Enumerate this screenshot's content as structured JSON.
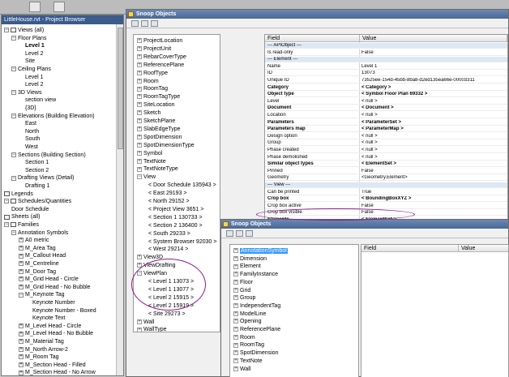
{
  "project_browser": {
    "title": "LittleHouse.rvt - Project Browser",
    "rows": [
      {
        "text": "Views (all)",
        "level": 0,
        "exp": "−",
        "icon": true
      },
      {
        "text": "Floor Plans",
        "level": 1,
        "exp": "−"
      },
      {
        "text": "Level 1",
        "level": 2,
        "bold": true
      },
      {
        "text": "Level 2",
        "level": 2
      },
      {
        "text": "Site",
        "level": 2
      },
      {
        "text": "Ceiling Plans",
        "level": 1,
        "exp": "−"
      },
      {
        "text": "Level 1",
        "level": 2
      },
      {
        "text": "Level 2",
        "level": 2
      },
      {
        "text": "3D Views",
        "level": 1,
        "exp": "−"
      },
      {
        "text": "section view",
        "level": 2
      },
      {
        "text": "{3D}",
        "level": 2
      },
      {
        "text": "Elevations (Building Elevation)",
        "level": 1,
        "exp": "−"
      },
      {
        "text": "East",
        "level": 2
      },
      {
        "text": "North",
        "level": 2
      },
      {
        "text": "South",
        "level": 2
      },
      {
        "text": "West",
        "level": 2
      },
      {
        "text": "Sections (Building Section)",
        "level": 1,
        "exp": "−"
      },
      {
        "text": "Section 1",
        "level": 2
      },
      {
        "text": "Section 2",
        "level": 2
      },
      {
        "text": "Drafting Views (Detail)",
        "level": 1,
        "exp": "−"
      },
      {
        "text": "Drafting 1",
        "level": 2
      },
      {
        "text": "Legends",
        "level": 0,
        "icon": true
      },
      {
        "text": "Schedules/Quantities",
        "level": 0,
        "exp": "−",
        "icon": true
      },
      {
        "text": "Door Schedule",
        "level": 1
      },
      {
        "text": "Sheets (all)",
        "level": 0,
        "icon": true
      },
      {
        "text": "Families",
        "level": 0,
        "exp": "−",
        "icon": true
      },
      {
        "text": "Annotation Symbols",
        "level": 1,
        "exp": "−"
      },
      {
        "text": "A0 metric",
        "level": 2,
        "exp": "+"
      },
      {
        "text": "M_Area Tag",
        "level": 2,
        "exp": "+"
      },
      {
        "text": "M_Callout Head",
        "level": 2,
        "exp": "+"
      },
      {
        "text": "M_Centreline",
        "level": 2,
        "exp": "+"
      },
      {
        "text": "M_Door Tag",
        "level": 2,
        "exp": "+"
      },
      {
        "text": "M_Grid Head - Circle",
        "level": 2,
        "exp": "+"
      },
      {
        "text": "M_Grid Head - No Bubble",
        "level": 2,
        "exp": "+"
      },
      {
        "text": "M_Keynote Tag",
        "level": 2,
        "exp": "−"
      },
      {
        "text": "Keynote Number",
        "level": 3
      },
      {
        "text": "Keynote Number - Boxed",
        "level": 3
      },
      {
        "text": "Keynote Text",
        "level": 3
      },
      {
        "text": "M_Level Head - Circle",
        "level": 2,
        "exp": "+"
      },
      {
        "text": "M_Level Head - No Bubble",
        "level": 2,
        "exp": "+"
      },
      {
        "text": "M_Material Tag",
        "level": 2,
        "exp": "+"
      },
      {
        "text": "M_North Arrow-2",
        "level": 2,
        "exp": "+"
      },
      {
        "text": "M_Room Tag",
        "level": 2,
        "exp": "+"
      },
      {
        "text": "M_Section Head - Filled",
        "level": 2,
        "exp": "+"
      },
      {
        "text": "M_Section Head - No Arrow",
        "level": 2,
        "exp": "+"
      }
    ]
  },
  "snoop1": {
    "title": "Snoop Objects",
    "tree": [
      {
        "text": "ProjectLocation",
        "level": 0,
        "exp": "+"
      },
      {
        "text": "ProjectUnit",
        "level": 0,
        "exp": "+"
      },
      {
        "text": "RebarCoverType",
        "level": 0,
        "exp": "+"
      },
      {
        "text": "ReferencePlane",
        "level": 0,
        "exp": "+"
      },
      {
        "text": "RoofType",
        "level": 0,
        "exp": "+"
      },
      {
        "text": "Room",
        "level": 0,
        "exp": "+"
      },
      {
        "text": "RoomTag",
        "level": 0,
        "exp": "+"
      },
      {
        "text": "RoomTagType",
        "level": 0,
        "exp": "+"
      },
      {
        "text": "SiteLocation",
        "level": 0,
        "exp": "+"
      },
      {
        "text": "Sketch",
        "level": 0,
        "exp": "+"
      },
      {
        "text": "SketchPlane",
        "level": 0,
        "exp": "+"
      },
      {
        "text": "SlabEdgeType",
        "level": 0,
        "exp": "+"
      },
      {
        "text": "SpotDimension",
        "level": 0,
        "exp": "+"
      },
      {
        "text": "SpotDimensionType",
        "level": 0,
        "exp": "+"
      },
      {
        "text": "Symbol",
        "level": 0,
        "exp": "+"
      },
      {
        "text": "TextNote",
        "level": 0,
        "exp": "+"
      },
      {
        "text": "TextNoteType",
        "level": 0,
        "exp": "+"
      },
      {
        "text": "View",
        "level": 0,
        "exp": "−"
      },
      {
        "text": "< Door Schedule  135943 >",
        "level": 1
      },
      {
        "text": "< East  29193 >",
        "level": 1
      },
      {
        "text": "< North  29152 >",
        "level": 1
      },
      {
        "text": "< Project View  3651 >",
        "level": 1
      },
      {
        "text": "< Section 1  130733 >",
        "level": 1
      },
      {
        "text": "< Section 2  136400 >",
        "level": 1
      },
      {
        "text": "< South  29233 >",
        "level": 1
      },
      {
        "text": "< System Browser  92030 >",
        "level": 1
      },
      {
        "text": "< West  29214 >",
        "level": 1
      },
      {
        "text": "View3D",
        "level": 0,
        "exp": "+"
      },
      {
        "text": "ViewDrafting",
        "level": 0,
        "exp": "+"
      },
      {
        "text": "ViewPlan",
        "level": 0,
        "exp": "−"
      },
      {
        "text": "< Level 1  13073 >",
        "level": 1
      },
      {
        "text": "< Level 1  13077 >",
        "level": 1
      },
      {
        "text": "< Level 2  15915 >",
        "level": 1
      },
      {
        "text": "< Level 2  15919 >",
        "level": 1
      },
      {
        "text": "< Site  29273 >",
        "level": 1
      },
      {
        "text": "Wall",
        "level": 0,
        "exp": "+"
      },
      {
        "text": "WallType",
        "level": 0,
        "exp": "+"
      }
    ],
    "grid_headers": {
      "field": "Field",
      "value": "Value"
    },
    "rows": [
      {
        "field": "--- APIObject ---",
        "value": "",
        "type": "cat"
      },
      {
        "field": "Is read-only",
        "value": "False"
      },
      {
        "field": "--- Element ---",
        "value": "",
        "type": "cat"
      },
      {
        "field": "Name",
        "value": "Level 1"
      },
      {
        "field": "ID",
        "value": "13073"
      },
      {
        "field": "Unique ID",
        "value": "73525ee-154d-45bb-8ba8-d2ed135ea66e-00003311"
      },
      {
        "field": "Category",
        "value": "< Category >",
        "bold": true
      },
      {
        "field": "Object type",
        "value": "< Symbol  Floor Plan  69332 >",
        "bold": true
      },
      {
        "field": "Level",
        "value": "< null >"
      },
      {
        "field": "Document",
        "value": "< Document >",
        "bold": true
      },
      {
        "field": "Location",
        "value": "< null >"
      },
      {
        "field": "Parameters",
        "value": "< ParameterSet >",
        "bold": true
      },
      {
        "field": "Parameters map",
        "value": "< ParameterMap >",
        "bold": true
      },
      {
        "field": "Design option",
        "value": "< null >"
      },
      {
        "field": "Group",
        "value": "< null >"
      },
      {
        "field": "Phase created",
        "value": "< null >"
      },
      {
        "field": "Phase demolished",
        "value": "< null >"
      },
      {
        "field": "Similar object types",
        "value": "< ElementSet >",
        "bold": true
      },
      {
        "field": "Pinned",
        "value": "False"
      },
      {
        "field": "Geometry",
        "value": "<Geometry.Element>"
      },
      {
        "field": "--- View ---",
        "value": "",
        "type": "cat"
      },
      {
        "field": "Can be printed",
        "value": "True"
      },
      {
        "field": "Crop box",
        "value": "< BoundingBoxXYZ >",
        "bold": true
      },
      {
        "field": "Crop box active",
        "value": "False"
      },
      {
        "field": "Crop box visible",
        "value": "False"
      },
      {
        "field": "Elements",
        "value": "< ElementSet >",
        "bold": true
      }
    ]
  },
  "snoop2": {
    "title": "Snoop Objects",
    "tree": [
      {
        "text": "AnnotationSymbol",
        "selected": true
      },
      {
        "text": "Dimension"
      },
      {
        "text": "Element"
      },
      {
        "text": "FamilyInstance"
      },
      {
        "text": "Floor"
      },
      {
        "text": "Grid"
      },
      {
        "text": "Group"
      },
      {
        "text": "IndependentTag"
      },
      {
        "text": "ModelLine"
      },
      {
        "text": "Opening"
      },
      {
        "text": "ReferencePlane"
      },
      {
        "text": "Room"
      },
      {
        "text": "RoomTag"
      },
      {
        "text": "SpotDimension"
      },
      {
        "text": "TextNote"
      },
      {
        "text": "Wall"
      }
    ],
    "grid_headers": {
      "field": "Field",
      "value": "Value"
    }
  },
  "colors": {
    "title_bar": "#4a6896",
    "highlight_ellipse": "#8b1a8b",
    "selection": "#3399ff",
    "category_row": "#dce8f4"
  }
}
